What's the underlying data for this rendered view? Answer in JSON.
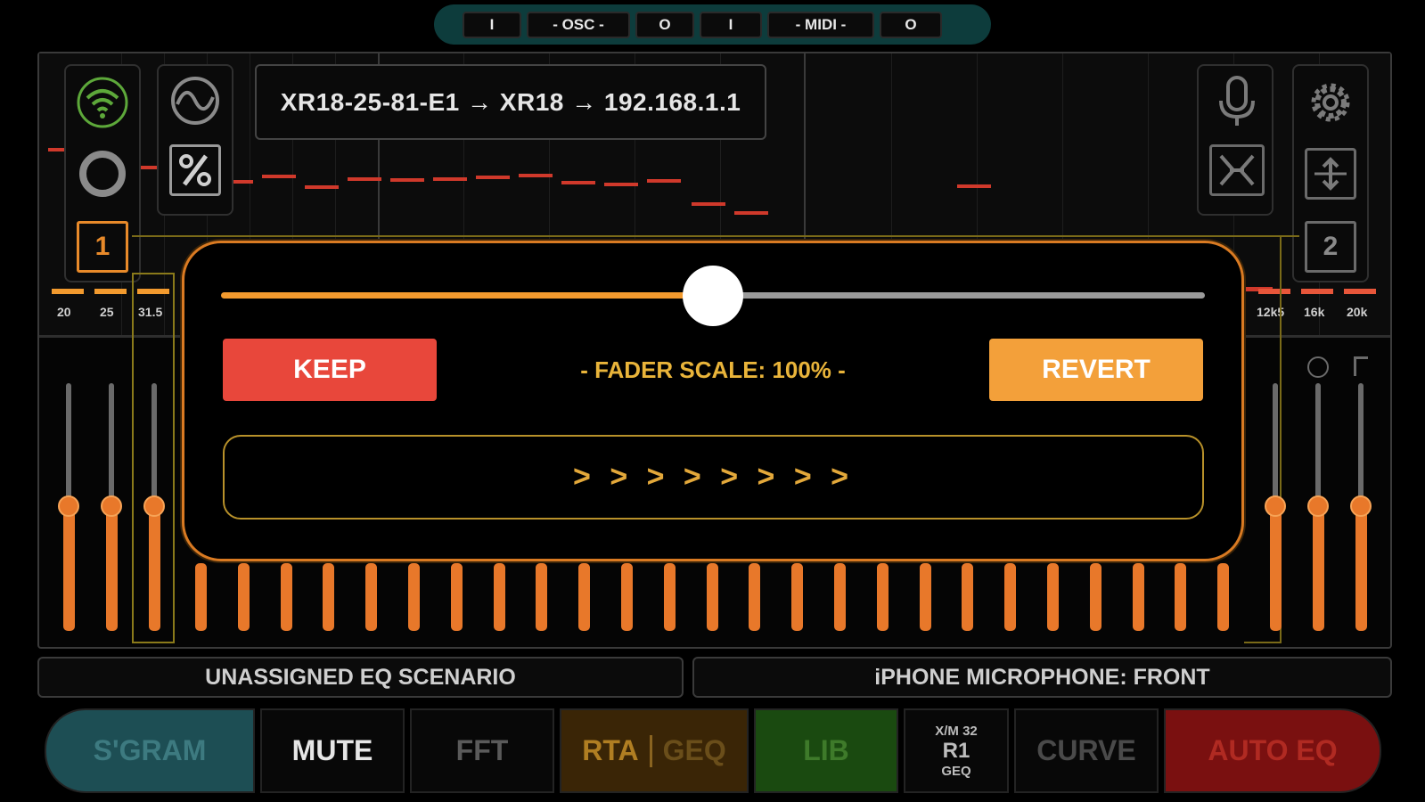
{
  "topbar": {
    "segments": [
      "I",
      "- OSC -",
      "O",
      "I",
      "- MIDI -",
      "O"
    ]
  },
  "connection": {
    "address": "XR18-25-81-E1 → XR18 → 192.168.1.1"
  },
  "left_panel": {
    "channel_number": "1"
  },
  "right_panel": {
    "channel_number": "2"
  },
  "freq_labels": {
    "left": [
      "20",
      "25",
      "31.5"
    ],
    "right": [
      "12k5",
      "16k",
      "20k"
    ]
  },
  "dialog": {
    "slider_value": 0.5,
    "keep_label": "KEEP",
    "revert_label": "REVERT",
    "fader_scale_label": "- FADER SCALE: 100% -",
    "slide_label": "> > > > > > > >"
  },
  "status": {
    "scenario": "UNASSIGNED EQ SCENARIO",
    "microphone": "iPHONE MICROPHONE: FRONT"
  },
  "nav": {
    "sgram": "S'GRAM",
    "mute": "MUTE",
    "fft": "FFT",
    "rta": "RTA",
    "geq": "GEQ",
    "lib": "LIB",
    "mixer_line1": "X/M 32",
    "mixer_line2": "R1",
    "mixer_line3": "GEQ",
    "curve": "CURVE",
    "auto_eq": "AUTO EQ"
  },
  "colors": {
    "accent_orange": "#f29a2e",
    "keep_red": "#e8473b",
    "revert_orange": "#f3a03a",
    "teal": "#0d3c3c",
    "rta_red": "#d0392b"
  }
}
